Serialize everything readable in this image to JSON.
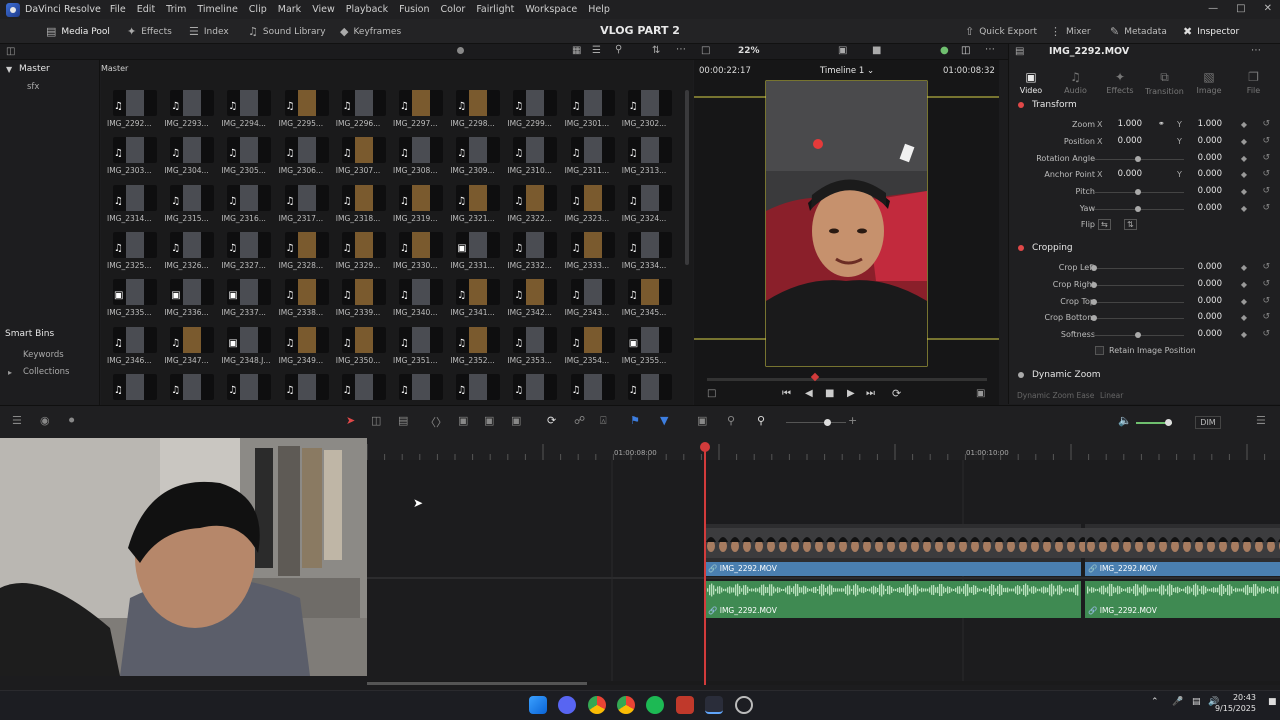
{
  "app": {
    "name": "DaVinci Resolve",
    "project_title": "VLOG PART 2"
  },
  "menu": [
    "File",
    "Edit",
    "Trim",
    "Timeline",
    "Clip",
    "Mark",
    "View",
    "Playback",
    "Fusion",
    "Color",
    "Fairlight",
    "Workspace",
    "Help"
  ],
  "toolbar": {
    "left": [
      {
        "label": "Media Pool",
        "icon": "media-pool-icon",
        "active": true
      },
      {
        "label": "Effects",
        "icon": "effects-icon"
      },
      {
        "label": "Index",
        "icon": "index-icon"
      },
      {
        "label": "Sound Library",
        "icon": "sound-library-icon"
      },
      {
        "label": "Keyframes",
        "icon": "keyframes-icon"
      }
    ],
    "right": [
      {
        "label": "Quick Export"
      },
      {
        "label": "Mixer"
      },
      {
        "label": "Metadata"
      },
      {
        "label": "Inspector",
        "active": true
      }
    ]
  },
  "viewer": {
    "zoom": "22%",
    "timecode_left": "00:00:22:17",
    "timeline_name": "Timeline 1",
    "timecode_right": "01:00:08:32"
  },
  "left_panel": {
    "master": "Master",
    "bin": "sfx",
    "smart_bins": "Smart Bins",
    "keywords": "Keywords",
    "collections": "Collections"
  },
  "media_pool": {
    "header": "Master",
    "clips": [
      "IMG_2292...",
      "IMG_2293...",
      "IMG_2294...",
      "IMG_2295...",
      "IMG_2296...",
      "IMG_2297...",
      "IMG_2298...",
      "IMG_2299...",
      "IMG_2301...",
      "IMG_2302...",
      "IMG_2303...",
      "IMG_2304...",
      "IMG_2305...",
      "IMG_2306...",
      "IMG_2307...",
      "IMG_2308...",
      "IMG_2309...",
      "IMG_2310...",
      "IMG_2311...",
      "IMG_2313...",
      "IMG_2314...",
      "IMG_2315...",
      "IMG_2316...",
      "IMG_2317...",
      "IMG_2318...",
      "IMG_2319...",
      "IMG_2321...",
      "IMG_2322...",
      "IMG_2323...",
      "IMG_2324...",
      "IMG_2325...",
      "IMG_2326...",
      "IMG_2327...",
      "IMG_2328...",
      "IMG_2329...",
      "IMG_2330...",
      "IMG_2331...",
      "IMG_2332...",
      "IMG_2333...",
      "IMG_2334...",
      "IMG_2335...",
      "IMG_2336...",
      "IMG_2337...",
      "IMG_2338...",
      "IMG_2339...",
      "IMG_2340...",
      "IMG_2341...",
      "IMG_2342...",
      "IMG_2343...",
      "IMG_2345...",
      "IMG_2346...",
      "IMG_2347...",
      "IMG_2348.J...",
      "IMG_2349...",
      "IMG_2350...",
      "IMG_2351...",
      "IMG_2352...",
      "IMG_2353...",
      "IMG_2354...",
      "IMG_2355...",
      "",
      "",
      "",
      "",
      "",
      "",
      "",
      "",
      "",
      ""
    ],
    "video_only": [
      36,
      40,
      41,
      42,
      52,
      59
    ],
    "warm": [
      3,
      5,
      6,
      14,
      24,
      25,
      26,
      27,
      28,
      33,
      34,
      35,
      38,
      43,
      44,
      46,
      47,
      49,
      51,
      53,
      54,
      56,
      58
    ]
  },
  "inspector": {
    "clip_name": "IMG_2292.MOV",
    "tabs": [
      {
        "label": "Video",
        "active": true
      },
      {
        "label": "Audio"
      },
      {
        "label": "Effects"
      },
      {
        "label": "Transition"
      },
      {
        "label": "Image"
      },
      {
        "label": "File"
      }
    ],
    "transform": {
      "title": "Transform",
      "zoom_label": "Zoom",
      "zoom_x": "1.000",
      "zoom_y": "1.000",
      "position_label": "Position",
      "position_x": "0.000",
      "position_y": "0.000",
      "rotation_label": "Rotation Angle",
      "rotation": "0.000",
      "anchor_label": "Anchor Point",
      "anchor_x": "0.000",
      "anchor_y": "0.000",
      "pitch_label": "Pitch",
      "pitch": "0.000",
      "yaw_label": "Yaw",
      "yaw": "0.000",
      "flip_label": "Flip"
    },
    "cropping": {
      "title": "Cropping",
      "rows": [
        {
          "label": "Crop Left",
          "value": "0.000"
        },
        {
          "label": "Crop Right",
          "value": "0.000"
        },
        {
          "label": "Crop Top",
          "value": "0.000"
        },
        {
          "label": "Crop Bottom",
          "value": "0.000"
        },
        {
          "label": "Softness",
          "value": "0.000"
        }
      ],
      "retain": "Retain Image Position"
    },
    "dynamic_zoom": {
      "title": "Dynamic Zoom",
      "ease_label": "Dynamic Zoom Ease",
      "ease_value": "Linear"
    }
  },
  "timeline": {
    "ruler": [
      "01:00:08:00",
      "01:00:10:00"
    ],
    "video_clips": [
      "IMG_2292.MOV",
      "IMG_2292.MOV"
    ],
    "audio_clips": [
      "IMG_2292.MOV",
      "IMG_2292.MOV"
    ],
    "dim": "DIM"
  },
  "taskbar": {
    "time": "20:43",
    "date": "9/15/2025"
  },
  "colors": {
    "accent": "#e04848",
    "clip_video": "#3f6f9c",
    "clip_audio": "#4e9a5a",
    "safe_guide": "#e8e14a",
    "playhead": "#d23b3b"
  }
}
